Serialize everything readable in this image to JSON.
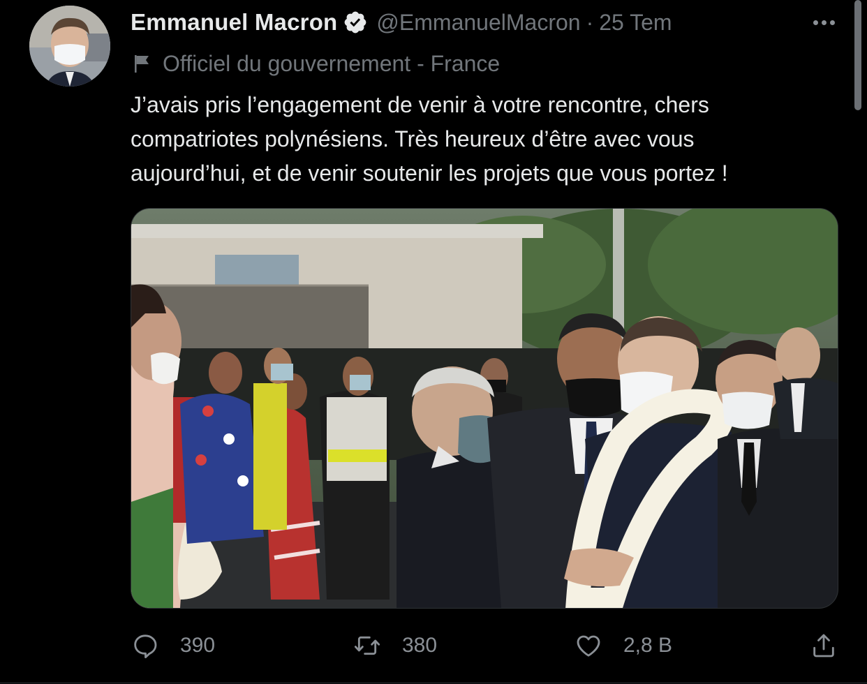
{
  "author": {
    "name": "Emmanuel Macron",
    "handle": "@EmmanuelMacron",
    "separator": "·",
    "date": "25 Tem",
    "verified": true
  },
  "account_label": "Officiel du gouvernement - France",
  "tweet": {
    "lines": [
      "J’avais pris l’engagement de venir à votre rencontre, chers",
      "compatriotes polynésiens. Très heureux d’être avec vous",
      "aujourd’hui, et de venir soutenir les projets que vous portez !"
    ]
  },
  "actions": {
    "reply_count": "390",
    "retweet_count": "380",
    "like_count": "2,8 B"
  },
  "icons": {
    "verified": "verified-badge-icon",
    "more": "more-icon",
    "label": "flag-icon",
    "reply": "reply-icon",
    "retweet": "retweet-icon",
    "like": "heart-icon",
    "share": "share-icon"
  },
  "colors": {
    "background": "#000000",
    "primary_text": "#e7e9ea",
    "secondary_text": "#71767b",
    "icon": "#8b9096"
  }
}
